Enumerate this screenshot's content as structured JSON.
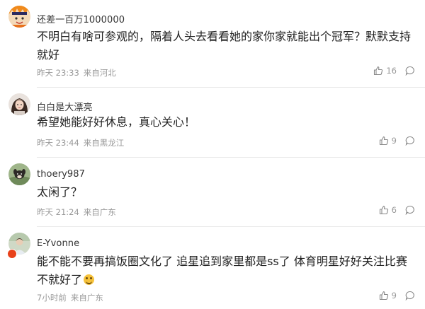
{
  "comments": [
    {
      "username": "还差一百万1000000",
      "content": "不明白有啥可参观的，隔着人头去看看她的家你家就能出个冠军？默默支持就好",
      "time": "昨天 23:33",
      "location": "来自河北",
      "likes": "16",
      "avatar_icon": "anime-boy-avatar"
    },
    {
      "username": "白白是大漂亮",
      "content": "希望她能好好休息，真心关心！",
      "time": "昨天 23:44",
      "location": "来自黑龙江",
      "likes": "9",
      "avatar_icon": "girl-avatar"
    },
    {
      "username": "thoery987",
      "content": "太闲了？",
      "time": "昨天 21:24",
      "location": "来自广东",
      "likes": "6",
      "avatar_icon": "dog-avatar"
    },
    {
      "username": "E-Yvonne",
      "content": "能不能不要再搞饭圈文化了 追星追到家里都是ss了 体育明星好好关注比赛不就好了",
      "time": "7小时前",
      "location": "来自广东",
      "likes": "9",
      "avatar_icon": "person-avatar",
      "emoji": "grinning-emoji"
    }
  ],
  "colors": {
    "text": "#222222",
    "meta": "#999999",
    "divider": "#e9e9e9",
    "badge": "#e8411a"
  }
}
